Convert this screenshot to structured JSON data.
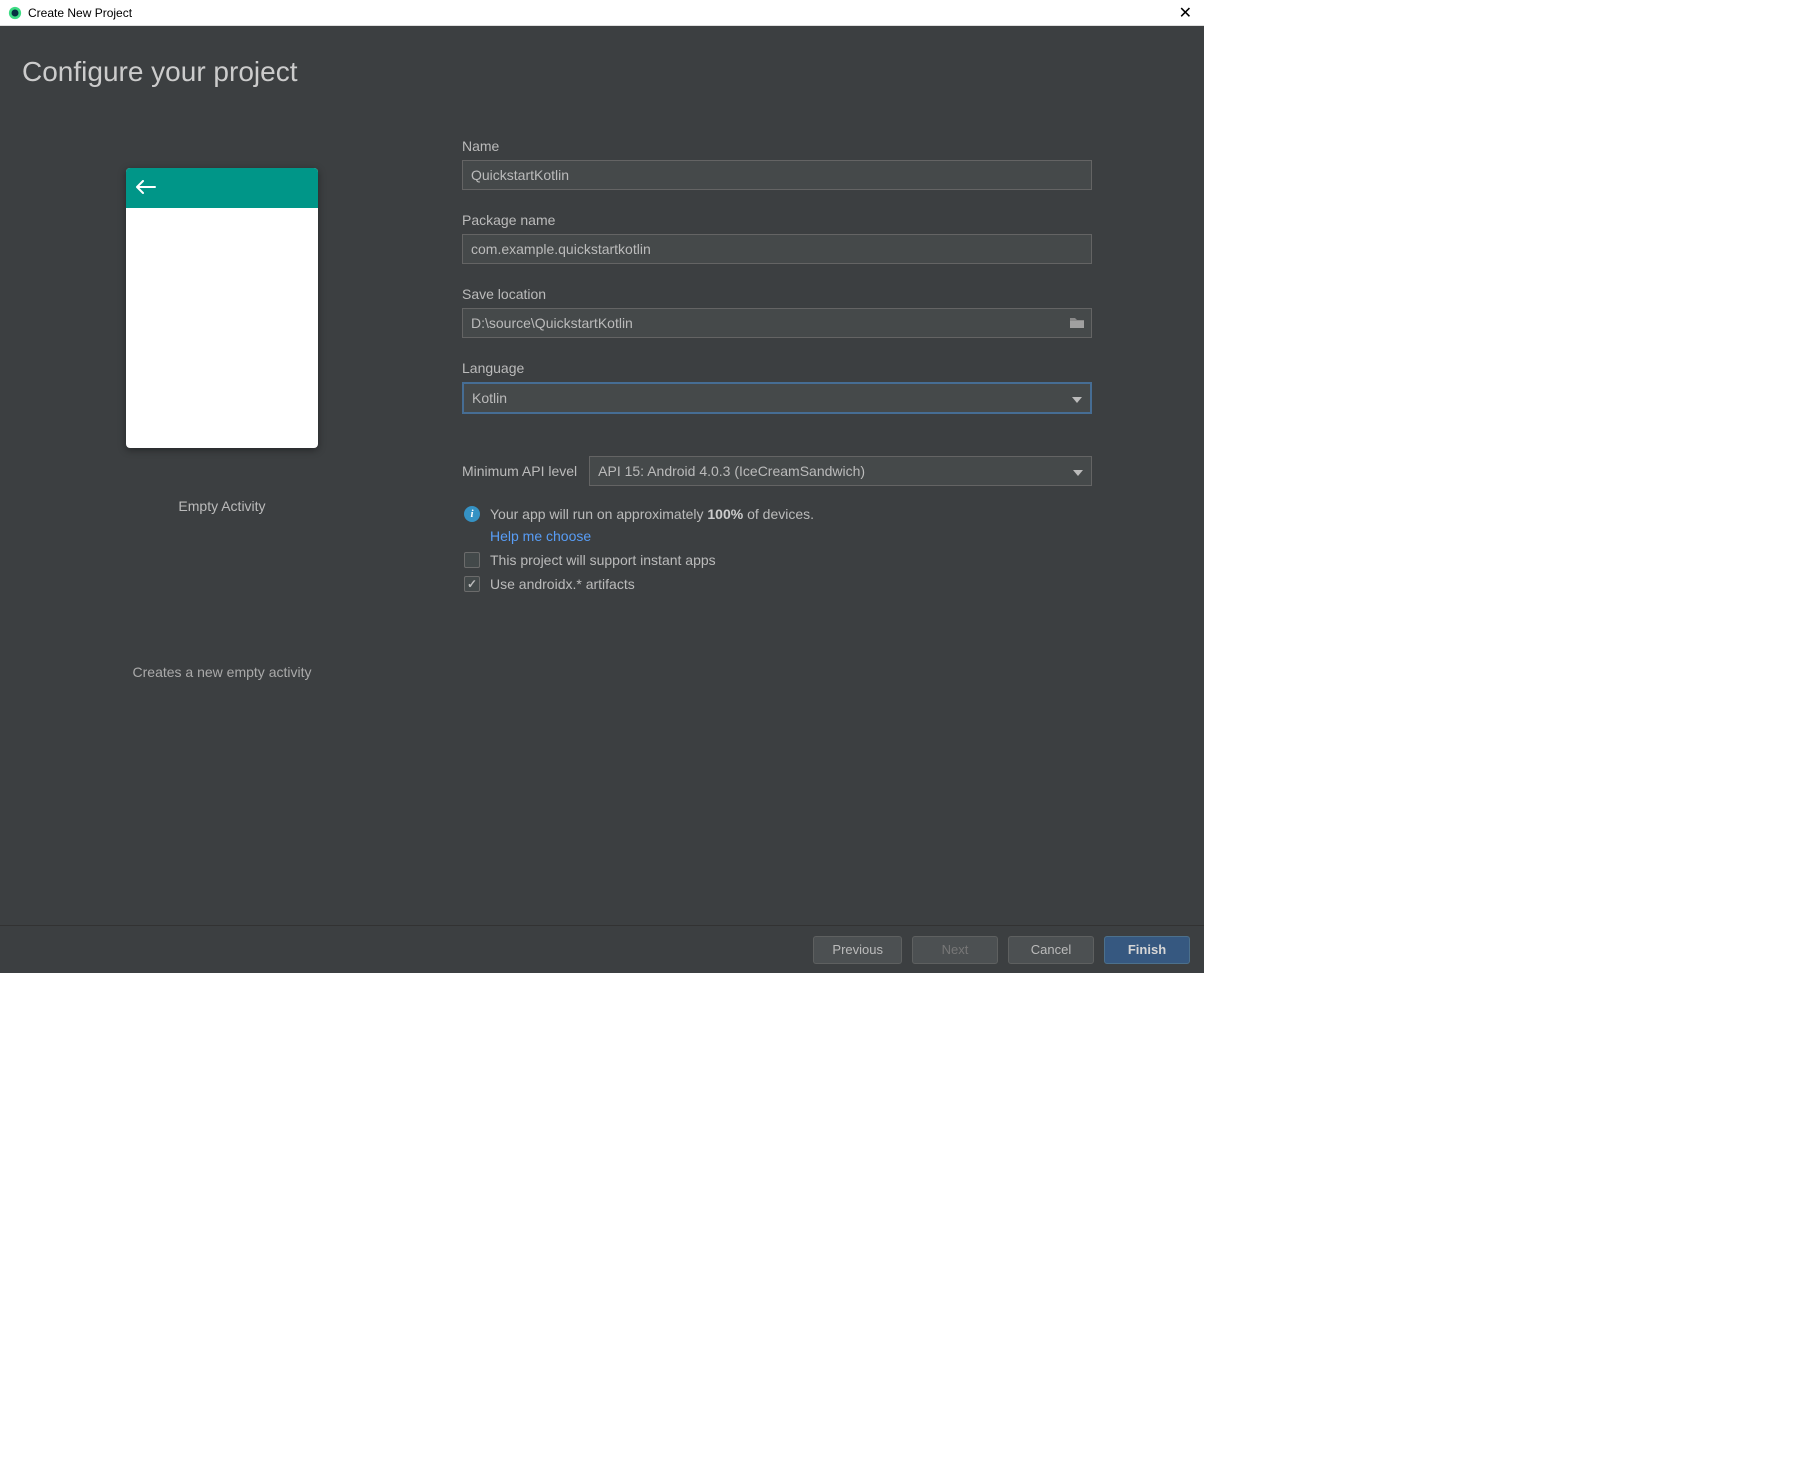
{
  "window": {
    "title": "Create New Project"
  },
  "page": {
    "title": "Configure your project"
  },
  "preview": {
    "label": "Empty Activity",
    "description": "Creates a new empty activity"
  },
  "form": {
    "name": {
      "label": "Name",
      "value": "QuickstartKotlin"
    },
    "package": {
      "label": "Package name",
      "value": "com.example.quickstartkotlin"
    },
    "location": {
      "label": "Save location",
      "value": "D:\\source\\QuickstartKotlin"
    },
    "language": {
      "label": "Language",
      "value": "Kotlin"
    },
    "api": {
      "label": "Minimum API level",
      "value": "API 15: Android 4.0.3 (IceCreamSandwich)"
    },
    "info": {
      "prefix": "Your app will run on approximately ",
      "percent": "100%",
      "suffix": " of devices."
    },
    "help": "Help me choose",
    "instant_apps": {
      "label": "This project will support instant apps",
      "checked": false
    },
    "androidx": {
      "label": "Use androidx.* artifacts",
      "checked": true
    }
  },
  "footer": {
    "previous": "Previous",
    "next": "Next",
    "cancel": "Cancel",
    "finish": "Finish"
  }
}
